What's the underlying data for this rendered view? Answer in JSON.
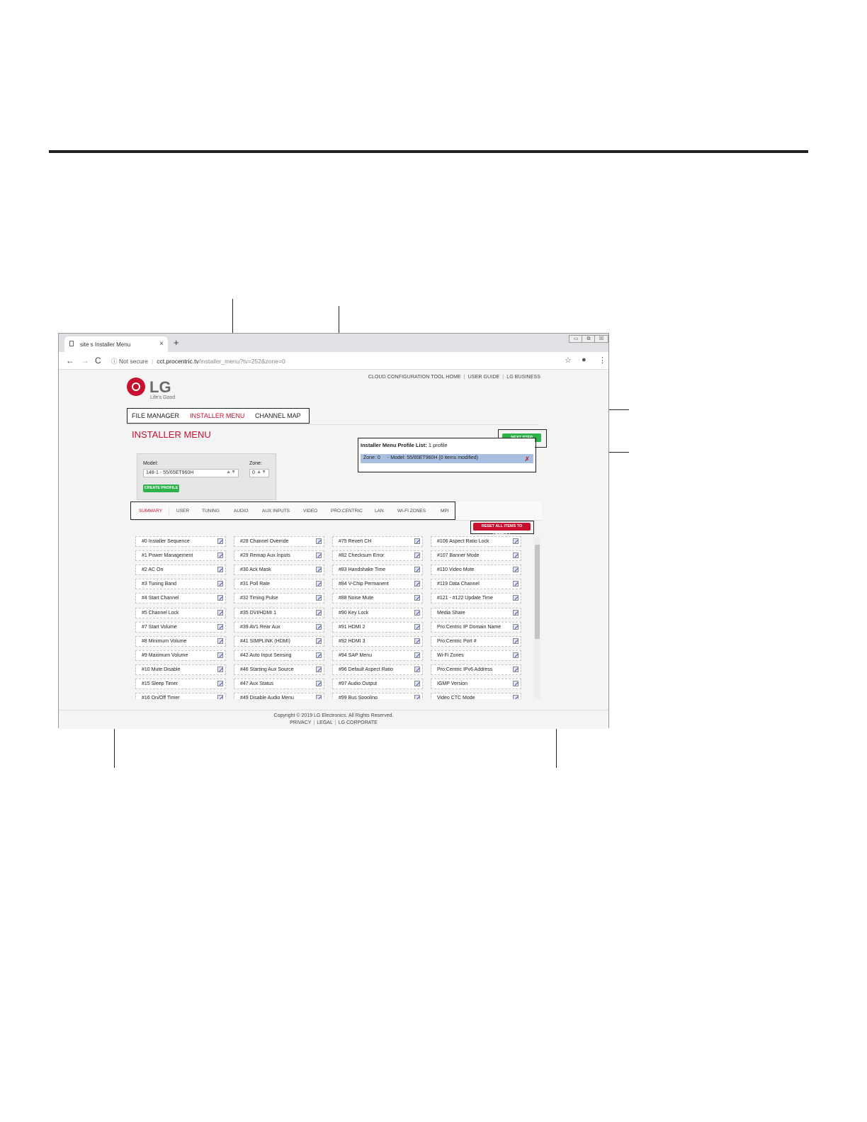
{
  "browser": {
    "tab_title": "site s Installer Menu",
    "tab_close": "×",
    "new_tab": "+",
    "security": "Not secure",
    "url_domain": "cct.procentric.tv",
    "url_path": "/installer_menu?tv=252&zone=0",
    "nav": {
      "back": "←",
      "forward": "→",
      "reload": "C"
    },
    "controls": [
      "▭",
      "⧉",
      "☒"
    ]
  },
  "site": {
    "top_links": [
      "CLOUD CONFIGURATION TOOL HOME",
      "USER GUIDE",
      "LG BUSINESS"
    ],
    "logo_text": "LG",
    "logo_tagline": "Life's Good",
    "main_nav": {
      "file_manager": "FILE MANAGER",
      "installer_menu": "INSTALLER MENU",
      "channel_map": "CHANNEL MAP"
    },
    "page_title": "INSTALLER MENU",
    "next_step": "NEXT STEP",
    "profile_list": {
      "label": "Installer Menu Profile List:",
      "count": "1 profile",
      "zone": "Zone: 0",
      "model": "- Model: 55/65ET960H (0 items modified)",
      "delete": "✗"
    },
    "model_label": "Model:",
    "model_value": "148-1 - 55/65ET960H",
    "zone_label": "Zone:",
    "zone_value": "0",
    "create_profile": "CREATE PROFILE",
    "tabs": [
      "SUMMARY",
      "USER",
      "TUNING",
      "AUDIO",
      "AUX INPUTS",
      "VIDEO",
      "PRO:CENTRIC",
      "LAN",
      "WI-FI ZONES",
      "MPI"
    ],
    "reset_all": "RESET ALL ITEMS TO DEFAULT",
    "items": [
      [
        "#0 Installer Sequence",
        "#1 Power Management",
        "#2 AC On",
        "#3 Tuning Band",
        "#4 Start Channel",
        "#5 Channel Lock",
        "#7 Start Volume",
        "#8 Minimum Volume",
        "#9 Maximum Volume",
        "#10 Mute Disable",
        "#15 Sleep Timer",
        "#16 On/Off Timer"
      ],
      [
        "#28 Channel Override",
        "#29 Remap Aux Inputs",
        "#30 Ack Mask",
        "#31 Poll Rate",
        "#32 Timing Pulse",
        "#35 DVI/HDMI 1",
        "#39 AV1 Rear Aux",
        "#41 SIMPLINK (HDMI)",
        "#42 Auto Input Sensing",
        "#46 Starting Aux Source",
        "#47 Aux Status",
        "#49 Disable Audio Menu"
      ],
      [
        "#75 Revert CH",
        "#82 Checksum Error",
        "#83 Handshake Time",
        "#84 V-Chip Permanent",
        "#88 Noise Mute",
        "#90 Key Lock",
        "#91 HDMI 2",
        "#92 HDMI 3",
        "#94 SAP Menu",
        "#96 Default Aspect Ratio",
        "#97 Audio Output",
        "#99 Bus Spooling"
      ],
      [
        "#106 Aspect Ratio Lock",
        "#107 Banner Mode",
        "#110 Video Mute",
        "#119 Data Channel",
        "#121 - #122 Update Time",
        "Media Share",
        "Pro:Centric IP Domain Name",
        "Pro:Centric Port #",
        "Wi-Fi Zones",
        "Pro:Centric IPv6 Address",
        "IGMP Version",
        "Video CTC Mode"
      ]
    ],
    "footer": {
      "copyright": "Copyright © 2019 LG Electronics. All Rights Reserved.",
      "links": [
        "PRIVACY",
        "LEGAL",
        "LG CORPORATE"
      ]
    }
  }
}
